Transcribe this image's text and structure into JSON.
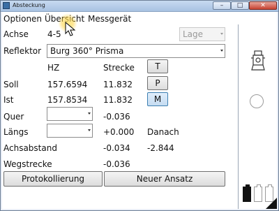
{
  "window": {
    "title": "Absteckung",
    "min_glyph": "–",
    "max_glyph": "□",
    "close_glyph": "✕"
  },
  "menu": [
    "Optionen",
    "Übersicht",
    "Messgerät"
  ],
  "achse": {
    "label": "Achse",
    "value": "4-5"
  },
  "lage": {
    "value": "Lage"
  },
  "reflektor": {
    "label": "Reflektor",
    "value": "Burg 360° Prisma"
  },
  "columns": {
    "hz": "HZ",
    "strecke": "Strecke"
  },
  "buttons": {
    "t": "T",
    "p": "P",
    "m": "M",
    "protokoll": "Protokollierung",
    "ansatz": "Neuer Ansatz"
  },
  "soll": {
    "label": "Soll",
    "hz": "157.6594",
    "strecke": "11.832"
  },
  "ist": {
    "label": "Ist",
    "hz": "157.8534",
    "strecke": "11.832"
  },
  "quer": {
    "label": "Quer",
    "select_value": "",
    "value": "-0.036"
  },
  "laengs": {
    "label": "Längs",
    "select_value": "",
    "value": "+0.000",
    "extra": "Danach"
  },
  "achsabstand": {
    "label": "Achsabstand",
    "value": "-0.034",
    "extra": "-2.844"
  },
  "wegstrecke": {
    "label": "Wegstrecke",
    "value": "-0.036"
  },
  "battery": [
    1,
    0,
    0
  ]
}
